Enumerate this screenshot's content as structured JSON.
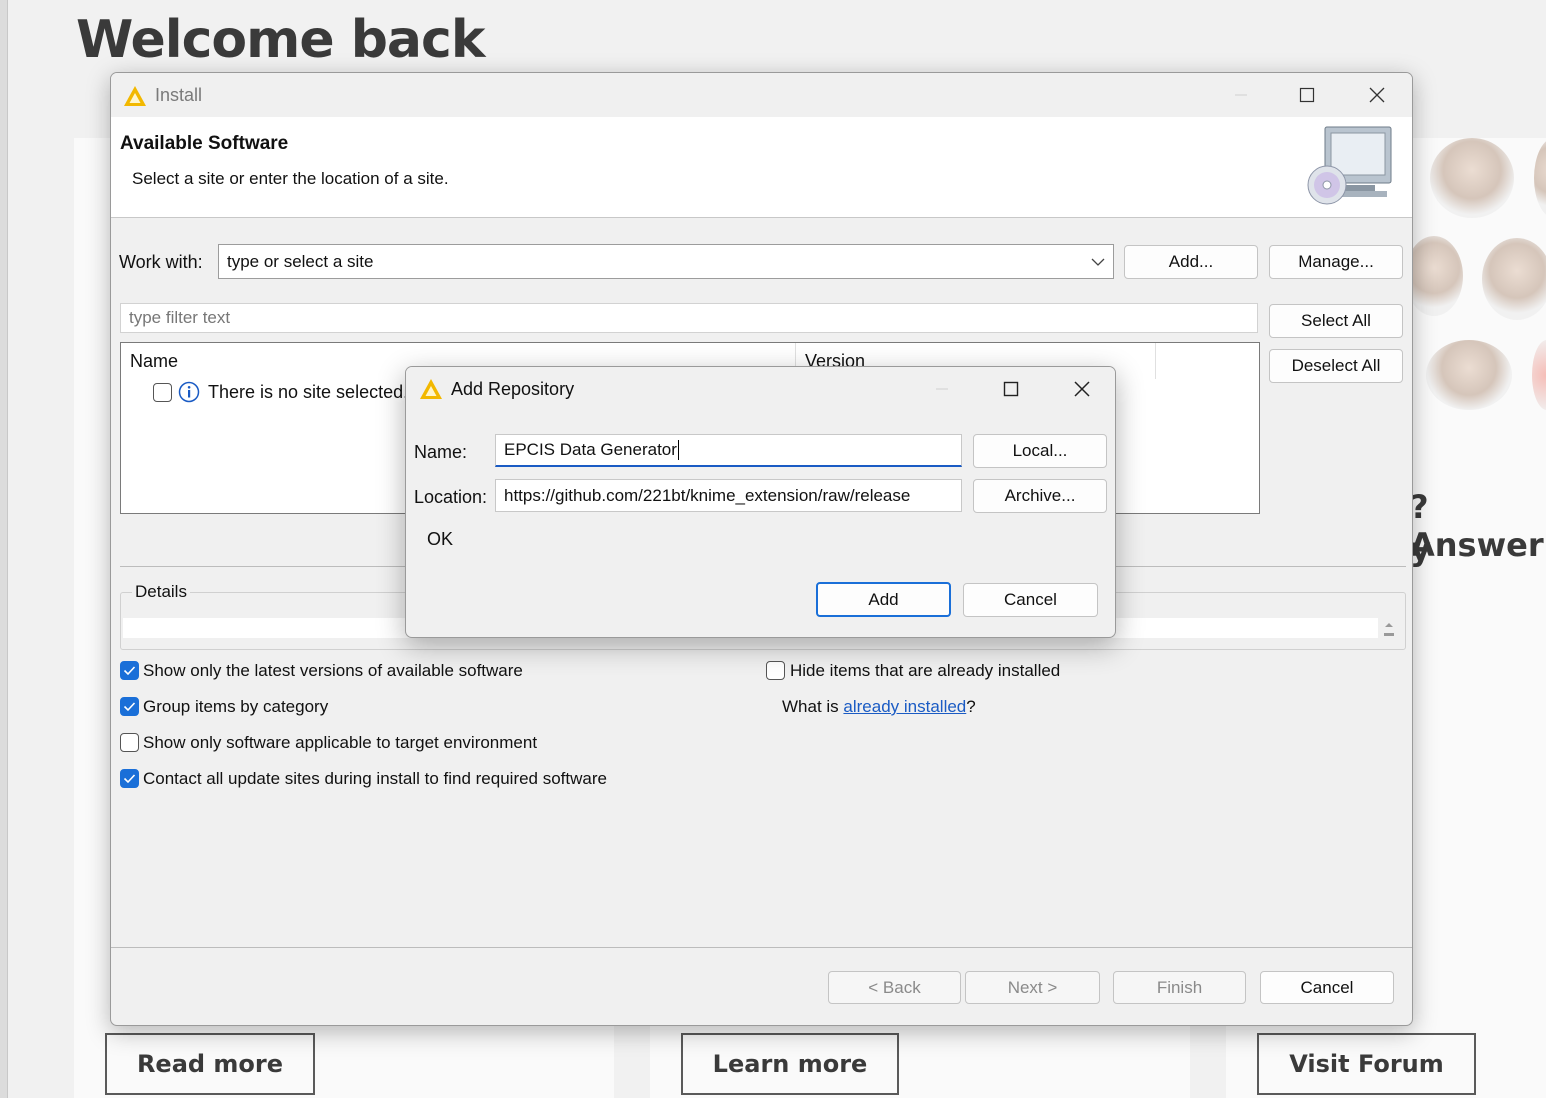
{
  "background": {
    "heading": "Welcome back",
    "answer_partial_1": "? Answer",
    "answer_partial_2": "y",
    "read_more": "Read more",
    "learn_more": "Learn more",
    "visit_forum": "Visit Forum"
  },
  "install": {
    "title": "Install",
    "banner_title": "Available Software",
    "banner_subtitle": "Select a site or enter the location of a site.",
    "work_with_label": "Work with:",
    "work_with_value": "type or select a site",
    "add_button": "Add...",
    "manage_button": "Manage...",
    "filter_placeholder": "type filter text",
    "select_all": "Select All",
    "deselect_all": "Deselect All",
    "columns": {
      "name": "Name",
      "version": "Version"
    },
    "tree_message": "There is no site selected.",
    "details_label": "Details",
    "options": {
      "latest_only": "Show only the latest versions of available software",
      "group_by_category": "Group items by category",
      "target_env_only": "Show only software applicable to target environment",
      "contact_all_sites": "Contact all update sites during install to find required software",
      "hide_installed": "Hide items that are already installed",
      "what_is_prefix": "What is ",
      "already_installed_link": "already installed",
      "what_is_suffix": "?"
    },
    "footer": {
      "back": "< Back",
      "next": "Next >",
      "finish": "Finish",
      "cancel": "Cancel"
    }
  },
  "add_repository": {
    "title": "Add Repository",
    "name_label": "Name:",
    "name_value": "EPCIS Data Generator",
    "location_label": "Location:",
    "location_value": "https://github.com/221bt/knime_extension/raw/release",
    "local_button": "Local...",
    "archive_button": "Archive...",
    "status": "OK",
    "add_button": "Add",
    "cancel_button": "Cancel"
  },
  "colors": {
    "accent": "#1a6fd8",
    "warning_icon": "#f2b800",
    "link": "#1a5bc4"
  }
}
